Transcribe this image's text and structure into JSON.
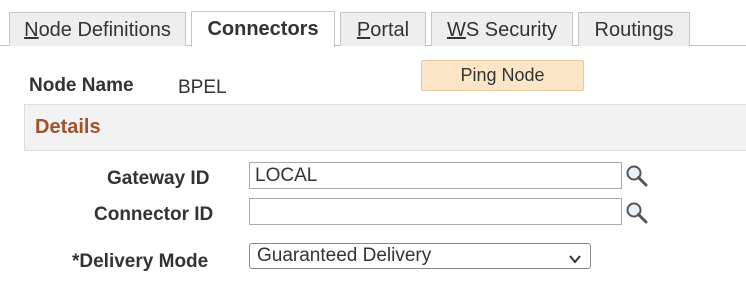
{
  "tabs": [
    {
      "pre": "",
      "u": "N",
      "post": "ode Definitions"
    },
    {
      "pre": "Connectors",
      "u": "",
      "post": ""
    },
    {
      "pre": "",
      "u": "P",
      "post": "ortal"
    },
    {
      "pre": "",
      "u": "W",
      "post": "S Security"
    },
    {
      "pre": "Routings",
      "u": "",
      "post": ""
    }
  ],
  "node": {
    "label": "Node Name",
    "value": "BPEL"
  },
  "ping_button": "Ping Node",
  "section": {
    "title": "Details"
  },
  "gateway": {
    "label": "Gateway ID",
    "value": "LOCAL"
  },
  "connector": {
    "label": "Connector ID",
    "value": ""
  },
  "delivery": {
    "label": "*Delivery Mode",
    "value": "Guaranteed Delivery"
  },
  "icons": {
    "lookup": "magnifier-icon",
    "dropdown": "chevron-down-icon"
  },
  "colors": {
    "section_title": "#a0522d",
    "button_bg": "#fce6c7",
    "tab_bg": "#eeeeee"
  }
}
